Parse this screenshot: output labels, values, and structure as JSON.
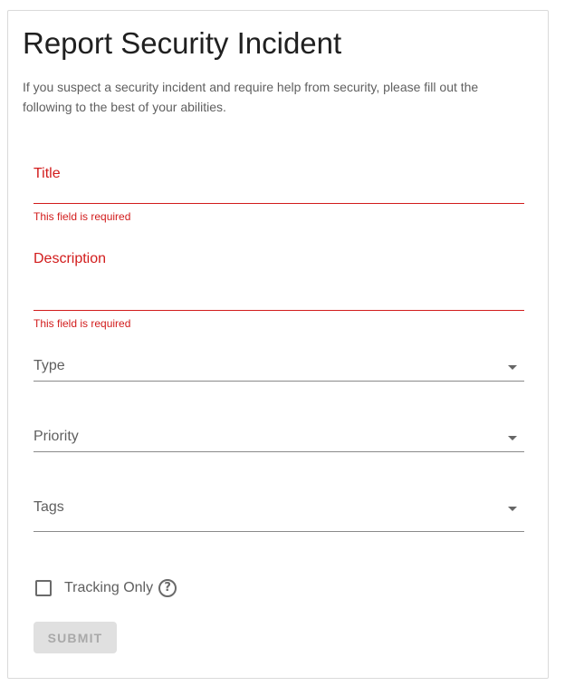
{
  "form": {
    "title": "Report Security Incident",
    "intro": "If you suspect a security incident and require help from security, please fill out the following to the best of your abilities.",
    "fields": {
      "title": {
        "label": "Title",
        "value": "",
        "error": "This field is required"
      },
      "description": {
        "label": "Description",
        "value": "",
        "error": "This field is required"
      },
      "type": {
        "label": "Type",
        "value": ""
      },
      "priority": {
        "label": "Priority",
        "value": ""
      },
      "tags": {
        "label": "Tags",
        "value": ""
      }
    },
    "tracking_only": {
      "label": "Tracking Only",
      "checked": false,
      "help_icon": "help-circle-icon"
    },
    "submit_label": "SUBMIT"
  },
  "colors": {
    "error": "#d21c1c",
    "text_secondary": "#5f5f5f",
    "disabled_button_bg": "#e0e0e0",
    "disabled_button_text": "#a9a9a9"
  }
}
